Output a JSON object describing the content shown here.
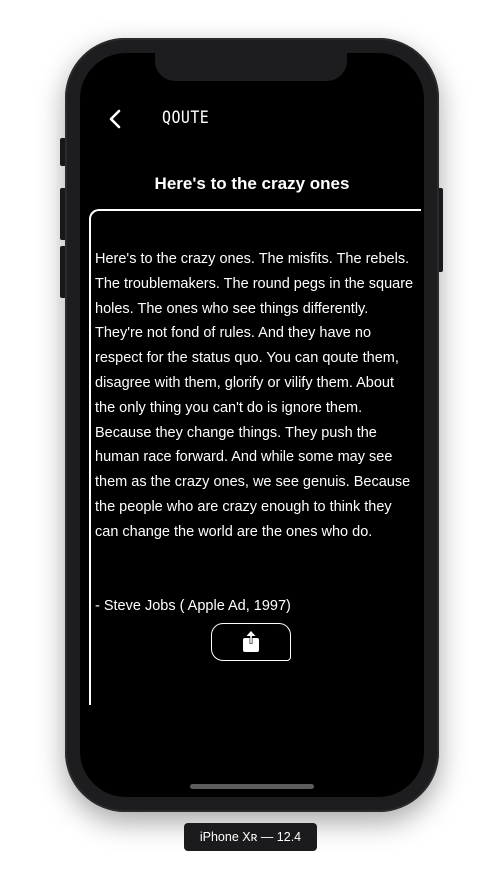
{
  "nav": {
    "back_icon": "chevron-left-icon",
    "title": "QOUTE"
  },
  "quote": {
    "title": "Here's to the crazy ones",
    "body": "Here's to the crazy ones. The misfits. The rebels. The troublemakers. The round pegs in the square holes. The ones who see things differently. They're not fond of rules. And they have no respect for the status quo. You can qoute them, disagree with them, glorify or vilify them. About the only thing you can't do is ignore them. Because they change things. They push the human race forward. And while some may see them as the crazy ones, we see genuis. Because the people who are crazy enough to think they can change the world are the ones who do.",
    "author": "- Steve Jobs ( Apple Ad, 1997)",
    "share_icon": "share-icon"
  },
  "simulator": {
    "label": "iPhone Xʀ — 12.4"
  },
  "colors": {
    "screen_bg": "#000000",
    "text": "#ffffff",
    "frame": "#1d1d1f"
  }
}
